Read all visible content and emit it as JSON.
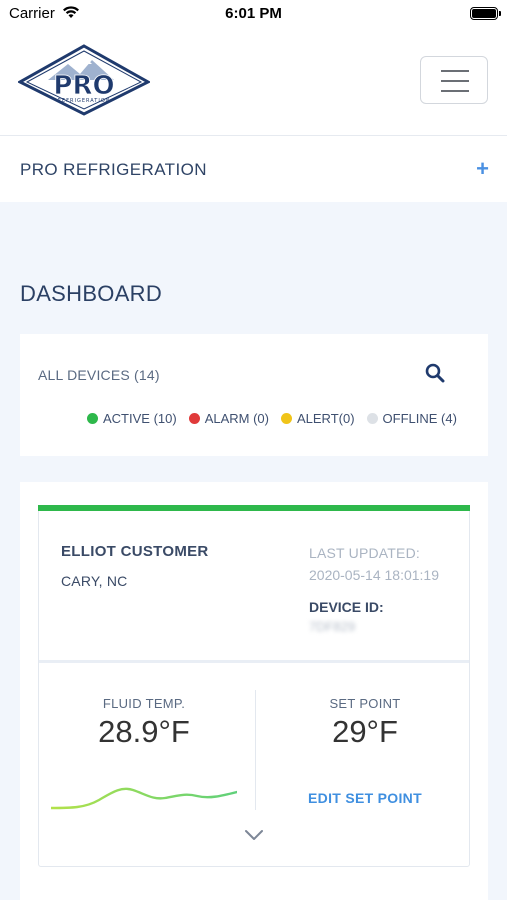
{
  "status_bar": {
    "carrier": "Carrier",
    "time": "6:01 PM"
  },
  "header": {
    "logo_text": "PRO",
    "logo_subtext": "REFRIGERATION"
  },
  "company": {
    "name": "PRO REFRIGERATION",
    "expand_symbol": "+"
  },
  "dashboard": {
    "title": "DASHBOARD",
    "all_devices": "ALL DEVICES (14)",
    "legend": [
      {
        "label": "ACTIVE (10)",
        "color": "#2eb84b"
      },
      {
        "label": "ALARM (0)",
        "color": "#e03a3a"
      },
      {
        "label": "ALERT(0)",
        "color": "#f0c419"
      },
      {
        "label": "OFFLINE (4)",
        "color": "#dde1e6"
      }
    ]
  },
  "device": {
    "status_color": "#2eb84b",
    "customer": "ELLIOT CUSTOMER",
    "location": "CARY, NC",
    "last_updated_label": "LAST UPDATED:",
    "last_updated_value": "2020-05-14 18:01:19",
    "device_id_label": "DEVICE ID:",
    "device_id_value": "7DF829",
    "fluid_temp_label": "FLUID TEMP.",
    "fluid_temp_value": "28.9°F",
    "set_point_label": "SET POINT",
    "set_point_value": "29°F",
    "edit_set_point": "EDIT SET POINT"
  }
}
